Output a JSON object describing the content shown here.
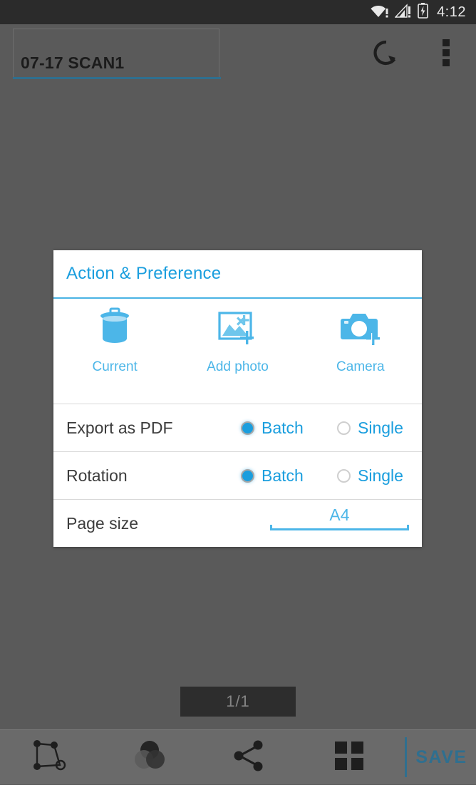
{
  "statusbar": {
    "time": "4:12",
    "icons": [
      "wifi-warning-icon",
      "cellular-warning-icon",
      "battery-charging-icon"
    ]
  },
  "appbar": {
    "title_value": "07-17 SCAN1",
    "title_placeholder": "Document name",
    "rotate_label": "rotate-icon",
    "overflow_label": "overflow-menu-icon"
  },
  "dialog": {
    "title": "Action & Preference",
    "actions": [
      {
        "label": "Current",
        "icon": "trash-icon"
      },
      {
        "label": "Add photo",
        "icon": "add-photo-icon"
      },
      {
        "label": "Camera",
        "icon": "camera-add-icon"
      }
    ],
    "preferences": [
      {
        "label": "Export as PDF",
        "options": [
          {
            "label": "Batch",
            "selected": true
          },
          {
            "label": "Single",
            "selected": false
          }
        ]
      },
      {
        "label": "Rotation",
        "options": [
          {
            "label": "Batch",
            "selected": true
          },
          {
            "label": "Single",
            "selected": false
          }
        ]
      }
    ],
    "page_size": {
      "label": "Page size",
      "value": "A4"
    }
  },
  "viewer": {
    "page_indicator": "1/1"
  },
  "bottombar": {
    "items": [
      {
        "name": "crop-icon"
      },
      {
        "name": "color-filter-icon"
      },
      {
        "name": "share-icon"
      },
      {
        "name": "grid-view-icon"
      }
    ],
    "save_label": "SAVE"
  },
  "colors": {
    "accent_blue": "#1a9ede",
    "icon_blue": "#4cb6e8",
    "save_blue": "#2f6f8f",
    "background": "#5a5a5a",
    "statusbar": "#2b2b2b",
    "bottombar": "#6a6a6a",
    "dialog_bg": "#ffffff"
  }
}
